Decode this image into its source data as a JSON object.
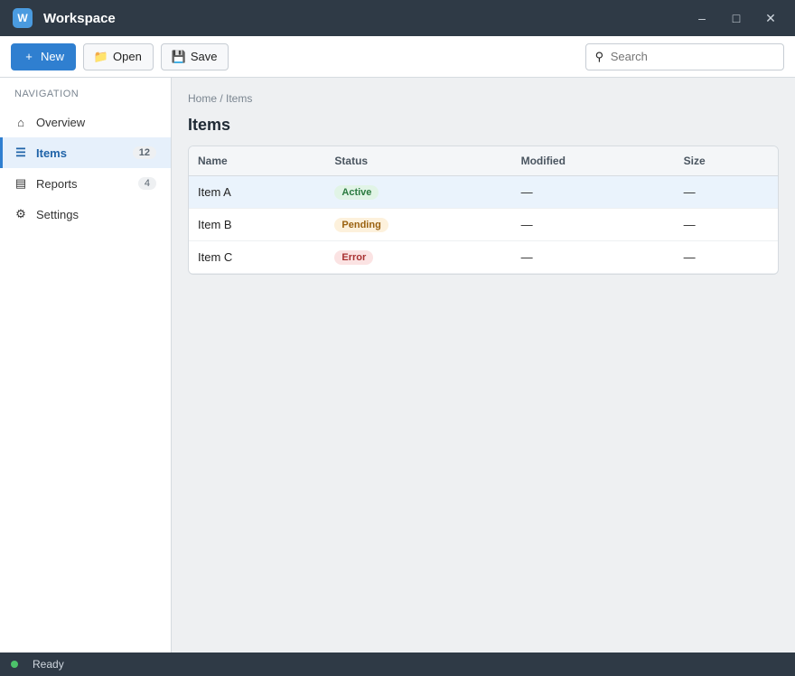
{
  "window": {
    "title": "Workspace",
    "app_icon_letter": "W"
  },
  "toolbar": {
    "new_label": "New",
    "open_label": "Open",
    "save_label": "Save",
    "search_placeholder": "Search"
  },
  "sidebar": {
    "heading": "Navigation",
    "items": [
      {
        "label": "Overview",
        "count": ""
      },
      {
        "label": "Items",
        "count": "12"
      },
      {
        "label": "Reports",
        "count": "4"
      },
      {
        "label": "Settings",
        "count": ""
      }
    ]
  },
  "main": {
    "breadcrumb": "Home / Items",
    "title": "Items",
    "table": {
      "columns": [
        "Name",
        "Status",
        "Modified",
        "Size"
      ],
      "rows": [
        {
          "name": "Item A",
          "status": "Active",
          "status_kind": "ok",
          "modified": "—",
          "size": "—"
        },
        {
          "name": "Item B",
          "status": "Pending",
          "status_kind": "warn",
          "modified": "—",
          "size": "—"
        },
        {
          "name": "Item C",
          "status": "Error",
          "status_kind": "err",
          "modified": "—",
          "size": "—"
        }
      ]
    }
  },
  "status": {
    "left": "Ready",
    "right": ""
  },
  "colors": {
    "accent": "#2f7fd0",
    "chrome": "#2f3a46"
  }
}
